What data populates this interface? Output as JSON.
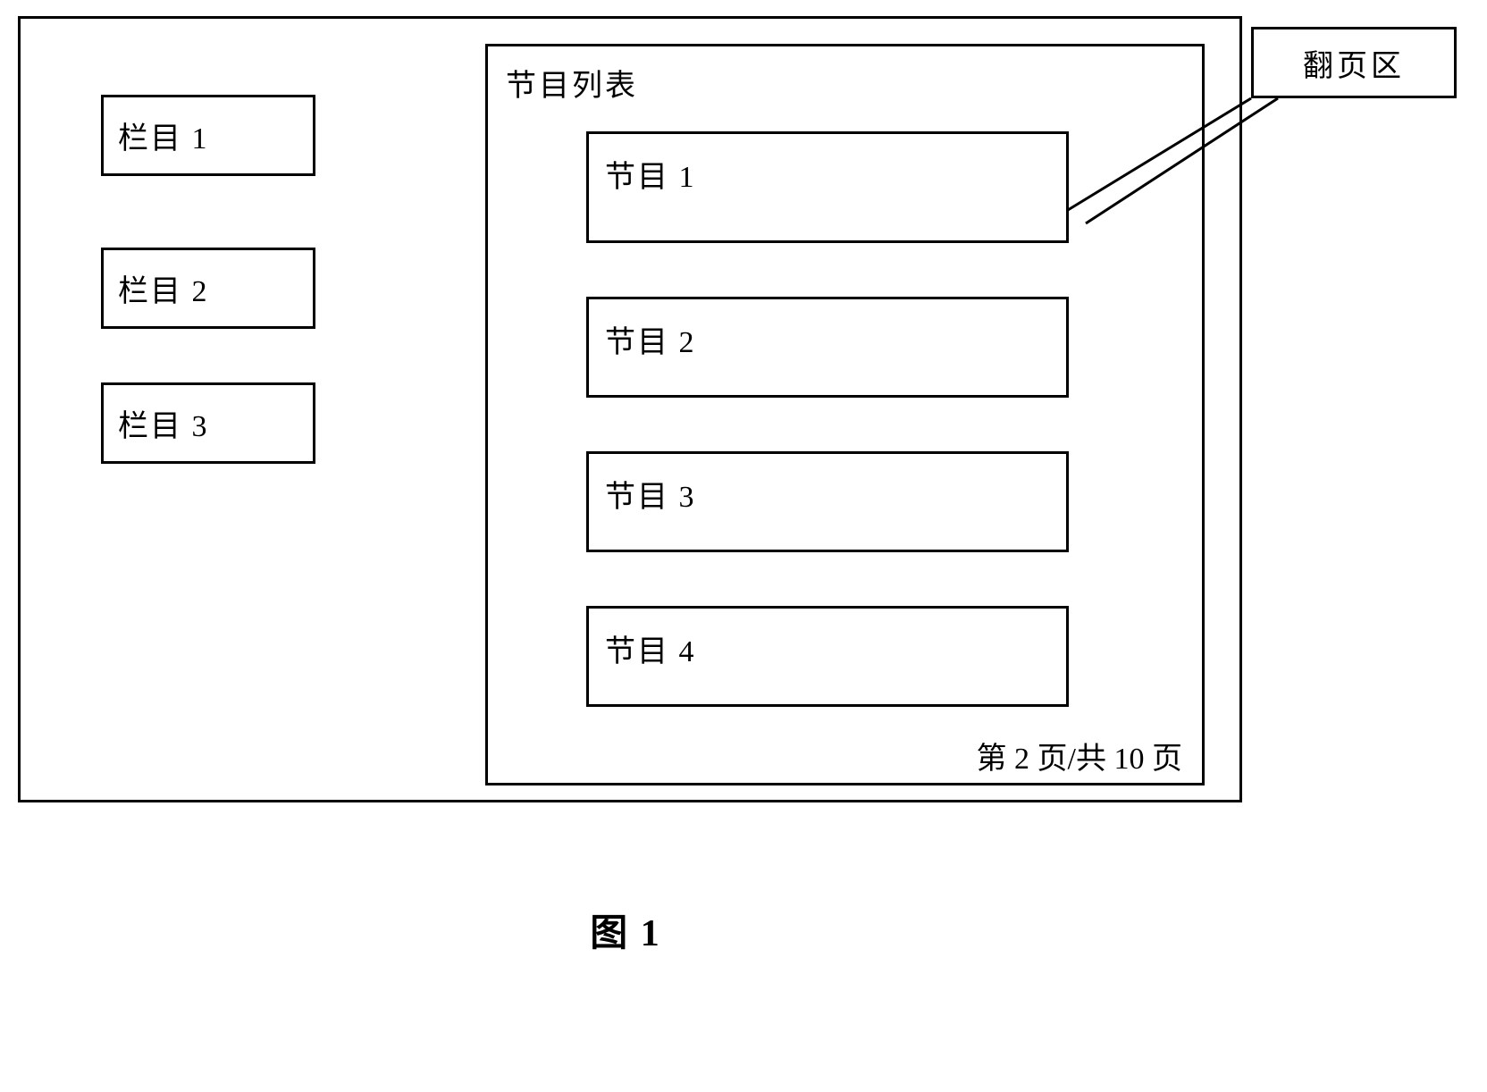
{
  "sidebar": {
    "items": [
      {
        "label": "栏目 1"
      },
      {
        "label": "栏目 2"
      },
      {
        "label": "栏目 3"
      }
    ]
  },
  "panel": {
    "title": "节目列表",
    "items": [
      {
        "label": "节目 1"
      },
      {
        "label": "节目 2"
      },
      {
        "label": "节目 3"
      },
      {
        "label": "节目 4"
      }
    ],
    "pageIndicator": "第 2 页/共 10 页"
  },
  "callout": {
    "label": "翻页区"
  },
  "figure": {
    "label": "图 1"
  }
}
